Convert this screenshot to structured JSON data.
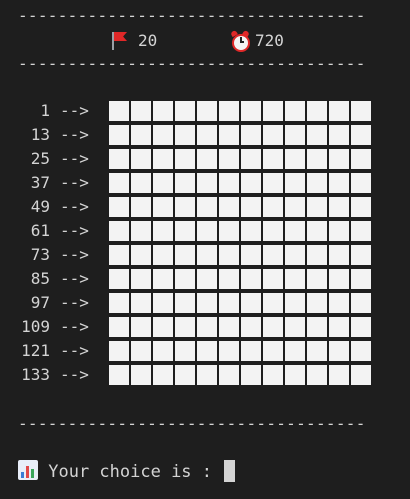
{
  "header": {
    "divider": "-----------------------------------",
    "flags_icon": "red-flag-icon",
    "flags_count": "20",
    "timer_icon": "alarm-clock-icon",
    "timer_value": "720"
  },
  "board": {
    "row_arrow": "-->",
    "columns": 12,
    "rows": [
      {
        "label": "1"
      },
      {
        "label": "13"
      },
      {
        "label": "25"
      },
      {
        "label": "37"
      },
      {
        "label": "49"
      },
      {
        "label": "61"
      },
      {
        "label": "73"
      },
      {
        "label": "85"
      },
      {
        "label": "97"
      },
      {
        "label": "109"
      },
      {
        "label": "121"
      },
      {
        "label": "133"
      }
    ],
    "cell_state": "unrevealed",
    "cell_color": "#f3f3f3"
  },
  "footer": {
    "divider": "-----------------------------------",
    "prompt_icon": "bar-chart-icon",
    "prompt_text": "Your choice is :"
  },
  "colors": {
    "background": "#1e1e1e",
    "text": "#d4d4d4",
    "flag": "#e02828"
  }
}
